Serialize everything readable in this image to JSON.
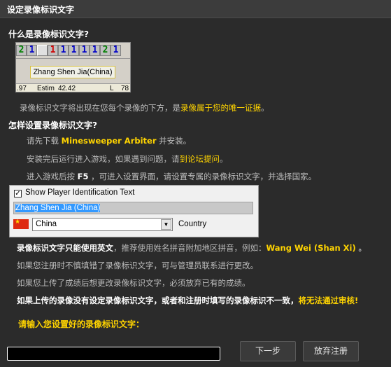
{
  "window": {
    "title": "设定录像标识文字"
  },
  "section1": {
    "heading": "什么是录像标识文字?",
    "preview": {
      "cells": [
        "2",
        "1",
        "",
        "■",
        "1",
        "1",
        "1",
        "1",
        "2",
        "1"
      ],
      "name": "Zhang Shen Jia(China)",
      "stat_left": ".97",
      "stat_estim_label": "Estim",
      "stat_estim": "42.42",
      "stat_l": "L",
      "stat_right": "78"
    },
    "desc_pre": "录像标识文字将出现在您每个录像的下方，是",
    "desc_hl": "录像属于您的唯一证据",
    "desc_post": "。"
  },
  "section2": {
    "heading": "怎样设置录像标识文字?",
    "step1_pre": "请先下载 ",
    "step1_hl": "Minesweeper Arbiter",
    "step1_post": " 并安装。",
    "step2_pre": "安装完后运行进入游戏，如果遇到问题，请",
    "step2_hl": "到论坛提问",
    "step2_post": "。",
    "step3_pre": "进入游戏后按 ",
    "step3_key": "F5",
    "step3_post": " ，可进入设置界面，请设置专属的录像标识文字，并选择国家。"
  },
  "settings_panel": {
    "checkbox_label": "Show Player Identification Text",
    "checkbox_mark": "✓",
    "id_text": "Zhang Shen Jia (China)",
    "country_value": "China",
    "country_label": "Country",
    "dropdown_arrow": "▼"
  },
  "notes": {
    "n1_pre": "录像标识文字只能使用英文",
    "n1_mid": "，推荐使用姓名拼音附加地区拼音，例如：",
    "n1_hl": "Wang Wei (Shan Xi)",
    "n1_post": " 。",
    "n2": "如果您注册时不慎填错了录像标识文字，可与管理员联系进行更改。",
    "n3": "如果您上传了成绩后想更改录像标识文字，必须放弃已有的成绩。",
    "n4_pre": "如果上传的录像没有设定录像标识文字，或者和注册时填写的录像标识不一致，",
    "n4_hl": "将无法通过审核!"
  },
  "prompt": "请输入您设置好的录像标识文字：",
  "input": {
    "value": "",
    "placeholder": ""
  },
  "buttons": {
    "next": "下一步",
    "cancel": "放弃注册"
  }
}
